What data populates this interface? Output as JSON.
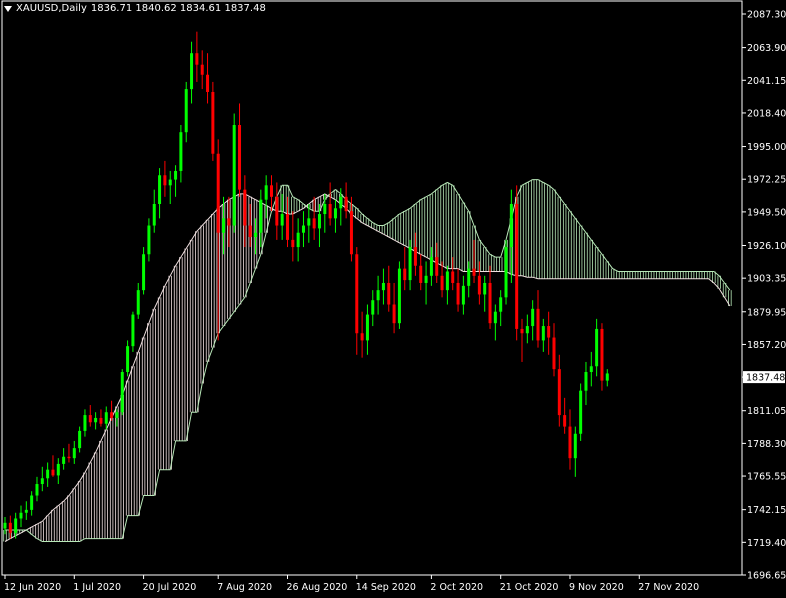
{
  "header": {
    "symbol": "XAUUSD,Daily",
    "ohlc": "1836.71 1840.62 1834.61 1837.48"
  },
  "current_price_label": "1837.48",
  "colors": {
    "background": "#000000",
    "bull": "#00ff00",
    "bear": "#ff0000",
    "cloud_bull": "#f0e0e0",
    "cloud_bear": "#b8e8b8",
    "axis": "#ffffff",
    "price_box": "#ffffff"
  },
  "chart_data": {
    "type": "candlestick",
    "title": "XAUUSD,Daily",
    "ylim": [
      1696.65,
      2087.3
    ],
    "y_ticks": [
      "2087.30",
      "2063.90",
      "2041.15",
      "2018.40",
      "1995.00",
      "1972.25",
      "1949.50",
      "1926.10",
      "1903.35",
      "1879.95",
      "1857.20",
      "1837.48",
      "1811.05",
      "1788.30",
      "1765.55",
      "1742.15",
      "1719.40",
      "1696.65"
    ],
    "y_tick_values": [
      2087.3,
      2063.9,
      2041.15,
      2018.4,
      1995.0,
      1972.25,
      1949.5,
      1926.1,
      1903.35,
      1879.95,
      1857.2,
      1834.45,
      1811.05,
      1788.3,
      1765.55,
      1742.15,
      1719.4,
      1696.65
    ],
    "x_ticks": [
      {
        "label": "12 Jun 2020",
        "index": 0
      },
      {
        "label": "1 Jul 2020",
        "index": 13
      },
      {
        "label": "20 Jul 2020",
        "index": 26
      },
      {
        "label": "7 Aug 2020",
        "index": 40
      },
      {
        "label": "26 Aug 2020",
        "index": 53
      },
      {
        "label": "14 Sep 2020",
        "index": 66
      },
      {
        "label": "2 Oct 2020",
        "index": 80
      },
      {
        "label": "21 Oct 2020",
        "index": 93
      },
      {
        "label": "9 Nov 2020",
        "index": 106
      },
      {
        "label": "27 Nov 2020",
        "index": 119
      }
    ],
    "candles": [
      [
        1729,
        1737,
        1725,
        1733
      ],
      [
        1733,
        1738,
        1722,
        1726
      ],
      [
        1726,
        1740,
        1722,
        1736
      ],
      [
        1736,
        1745,
        1730,
        1740
      ],
      [
        1740,
        1748,
        1735,
        1742
      ],
      [
        1742,
        1755,
        1738,
        1752
      ],
      [
        1752,
        1765,
        1748,
        1760
      ],
      [
        1760,
        1772,
        1755,
        1764
      ],
      [
        1764,
        1775,
        1758,
        1770
      ],
      [
        1770,
        1780,
        1765,
        1766
      ],
      [
        1766,
        1778,
        1760,
        1774
      ],
      [
        1774,
        1785,
        1770,
        1779
      ],
      [
        1779,
        1788,
        1775,
        1778
      ],
      [
        1778,
        1790,
        1774,
        1785
      ],
      [
        1785,
        1800,
        1782,
        1797
      ],
      [
        1797,
        1812,
        1793,
        1808
      ],
      [
        1808,
        1815,
        1800,
        1803
      ],
      [
        1803,
        1810,
        1798,
        1806
      ],
      [
        1806,
        1812,
        1800,
        1802
      ],
      [
        1802,
        1814,
        1798,
        1810
      ],
      [
        1810,
        1818,
        1804,
        1806
      ],
      [
        1806,
        1812,
        1800,
        1810
      ],
      [
        1810,
        1840,
        1808,
        1838
      ],
      [
        1838,
        1860,
        1835,
        1856
      ],
      [
        1856,
        1880,
        1852,
        1878
      ],
      [
        1878,
        1900,
        1875,
        1895
      ],
      [
        1895,
        1925,
        1892,
        1920
      ],
      [
        1920,
        1945,
        1915,
        1940
      ],
      [
        1940,
        1965,
        1935,
        1955
      ],
      [
        1955,
        1980,
        1945,
        1975
      ],
      [
        1975,
        1985,
        1960,
        1968
      ],
      [
        1968,
        1978,
        1955,
        1972
      ],
      [
        1972,
        1982,
        1960,
        1978
      ],
      [
        1978,
        2010,
        1970,
        2005
      ],
      [
        2005,
        2040,
        1998,
        2035
      ],
      [
        2035,
        2068,
        2025,
        2060
      ],
      [
        2060,
        2075,
        2040,
        2052
      ],
      [
        2052,
        2062,
        2035,
        2045
      ],
      [
        2045,
        2060,
        2025,
        2033
      ],
      [
        2033,
        2040,
        1985,
        1990
      ],
      [
        1990,
        2000,
        1860,
        1935
      ],
      [
        1935,
        1960,
        1920,
        1945
      ],
      [
        1945,
        1960,
        1925,
        1940
      ],
      [
        1940,
        2018,
        1935,
        2010
      ],
      [
        2010,
        2025,
        1960,
        1965
      ],
      [
        1965,
        1975,
        1925,
        1940
      ],
      [
        1940,
        1955,
        1925,
        1932
      ],
      [
        1932,
        1945,
        1920,
        1935
      ],
      [
        1935,
        1965,
        1925,
        1958
      ],
      [
        1958,
        1975,
        1945,
        1968
      ],
      [
        1968,
        1975,
        1950,
        1960
      ],
      [
        1960,
        1970,
        1930,
        1940
      ],
      [
        1940,
        1962,
        1930,
        1948
      ],
      [
        1948,
        1960,
        1925,
        1930
      ],
      [
        1930,
        1950,
        1915,
        1925
      ],
      [
        1925,
        1945,
        1915,
        1935
      ],
      [
        1935,
        1950,
        1925,
        1940
      ],
      [
        1940,
        1955,
        1928,
        1945
      ],
      [
        1945,
        1960,
        1930,
        1938
      ],
      [
        1938,
        1955,
        1925,
        1948
      ],
      [
        1948,
        1962,
        1935,
        1955
      ],
      [
        1955,
        1970,
        1940,
        1945
      ],
      [
        1945,
        1958,
        1935,
        1952
      ],
      [
        1952,
        1966,
        1940,
        1960
      ],
      [
        1960,
        1970,
        1945,
        1950
      ],
      [
        1950,
        1960,
        1915,
        1920
      ],
      [
        1920,
        1925,
        1850,
        1865
      ],
      [
        1865,
        1880,
        1848,
        1860
      ],
      [
        1860,
        1885,
        1850,
        1878
      ],
      [
        1878,
        1895,
        1870,
        1888
      ],
      [
        1888,
        1905,
        1878,
        1895
      ],
      [
        1895,
        1910,
        1885,
        1900
      ],
      [
        1900,
        1912,
        1880,
        1885
      ],
      [
        1885,
        1900,
        1865,
        1872
      ],
      [
        1872,
        1915,
        1868,
        1910
      ],
      [
        1910,
        1925,
        1895,
        1902
      ],
      [
        1902,
        1930,
        1895,
        1925
      ],
      [
        1925,
        1935,
        1905,
        1912
      ],
      [
        1912,
        1920,
        1895,
        1900
      ],
      [
        1900,
        1915,
        1885,
        1905
      ],
      [
        1905,
        1925,
        1898,
        1918
      ],
      [
        1918,
        1928,
        1900,
        1905
      ],
      [
        1905,
        1915,
        1890,
        1895
      ],
      [
        1895,
        1912,
        1885,
        1908
      ],
      [
        1908,
        1918,
        1895,
        1900
      ],
      [
        1900,
        1910,
        1880,
        1885
      ],
      [
        1885,
        1905,
        1878,
        1898
      ],
      [
        1898,
        1915,
        1890,
        1910
      ],
      [
        1910,
        1930,
        1900,
        1905
      ],
      [
        1905,
        1915,
        1885,
        1892
      ],
      [
        1892,
        1905,
        1880,
        1900
      ],
      [
        1900,
        1912,
        1868,
        1872
      ],
      [
        1872,
        1885,
        1860,
        1880
      ],
      [
        1880,
        1895,
        1870,
        1890
      ],
      [
        1890,
        1930,
        1885,
        1925
      ],
      [
        1925,
        1965,
        1900,
        1955
      ],
      [
        1955,
        1968,
        1860,
        1868
      ],
      [
        1868,
        1875,
        1845,
        1865
      ],
      [
        1865,
        1878,
        1858,
        1870
      ],
      [
        1870,
        1888,
        1860,
        1882
      ],
      [
        1882,
        1895,
        1855,
        1860
      ],
      [
        1860,
        1875,
        1852,
        1870
      ],
      [
        1870,
        1880,
        1850,
        1862
      ],
      [
        1862,
        1872,
        1835,
        1840
      ],
      [
        1840,
        1850,
        1800,
        1808
      ],
      [
        1808,
        1820,
        1795,
        1800
      ],
      [
        1800,
        1812,
        1770,
        1778
      ],
      [
        1778,
        1800,
        1765,
        1795
      ],
      [
        1795,
        1830,
        1790,
        1825
      ],
      [
        1825,
        1845,
        1815,
        1838
      ],
      [
        1838,
        1852,
        1828,
        1842
      ],
      [
        1842,
        1875,
        1835,
        1868
      ],
      [
        1868,
        1872,
        1825,
        1832
      ],
      [
        1832,
        1840,
        1828,
        1837
      ]
    ],
    "cloud": {
      "span_a": [
        1720,
        1722,
        1724,
        1726,
        1728,
        1730,
        1732,
        1734,
        1738,
        1742,
        1745,
        1748,
        1752,
        1757,
        1762,
        1768,
        1775,
        1782,
        1790,
        1798,
        1806,
        1814,
        1822,
        1832,
        1842,
        1852,
        1862,
        1872,
        1882,
        1890,
        1898,
        1905,
        1912,
        1918,
        1924,
        1930,
        1936,
        1940,
        1944,
        1948,
        1952,
        1955,
        1958,
        1960,
        1962,
        1962,
        1960,
        1958,
        1956,
        1954,
        1952,
        1950,
        1950,
        1948,
        1948,
        1950,
        1952,
        1955,
        1958,
        1960,
        1962,
        1960,
        1958,
        1955,
        1952,
        1948,
        1945,
        1942,
        1940,
        1938,
        1936,
        1934,
        1932,
        1930,
        1928,
        1926,
        1924,
        1922,
        1920,
        1918,
        1916,
        1914,
        1912,
        1910,
        1910,
        1910,
        1908,
        1908,
        1908,
        1908,
        1908,
        1908,
        1908,
        1908,
        1908,
        1906,
        1905,
        1905,
        1904,
        1904,
        1903,
        1903,
        1903,
        1903,
        1903,
        1903,
        1903,
        1903,
        1903,
        1903,
        1903,
        1903,
        1903,
        1903,
        1903,
        1903,
        1903,
        1903,
        1903,
        1903,
        1903,
        1903,
        1903,
        1903,
        1903,
        1903,
        1903,
        1903,
        1903,
        1903,
        1903,
        1903,
        1903,
        1900,
        1896,
        1890,
        1884,
        1876,
        1868,
        1862,
        1860,
        1858,
        1856,
        1854,
        1852,
        1850,
        1848
      ],
      "span_b": [
        1728,
        1728,
        1728,
        1728,
        1728,
        1725,
        1722,
        1720,
        1720,
        1720,
        1720,
        1720,
        1720,
        1720,
        1720,
        1722,
        1722,
        1722,
        1722,
        1722,
        1722,
        1722,
        1722,
        1738,
        1738,
        1738,
        1752,
        1752,
        1752,
        1770,
        1770,
        1770,
        1790,
        1790,
        1790,
        1810,
        1810,
        1830,
        1845,
        1855,
        1865,
        1870,
        1875,
        1880,
        1885,
        1890,
        1900,
        1910,
        1920,
        1935,
        1950,
        1960,
        1968,
        1968,
        1960,
        1958,
        1955,
        1952,
        1950,
        1950,
        1958,
        1962,
        1965,
        1962,
        1958,
        1955,
        1952,
        1948,
        1945,
        1942,
        1940,
        1940,
        1942,
        1945,
        1948,
        1950,
        1952,
        1955,
        1958,
        1960,
        1962,
        1965,
        1968,
        1970,
        1968,
        1962,
        1956,
        1950,
        1940,
        1930,
        1925,
        1920,
        1918,
        1918,
        1930,
        1945,
        1960,
        1968,
        1970,
        1972,
        1972,
        1970,
        1968,
        1965,
        1960,
        1955,
        1950,
        1945,
        1940,
        1935,
        1930,
        1925,
        1920,
        1915,
        1910,
        1908,
        1908,
        1908,
        1908,
        1908,
        1908,
        1908,
        1908,
        1908,
        1908,
        1908,
        1908,
        1908,
        1908,
        1908,
        1908,
        1908,
        1908,
        1908,
        1905,
        1900,
        1895,
        1890,
        1885,
        1880,
        1875,
        1870,
        1868,
        1868,
        1866,
        1866,
        1866,
        1866
      ]
    }
  }
}
